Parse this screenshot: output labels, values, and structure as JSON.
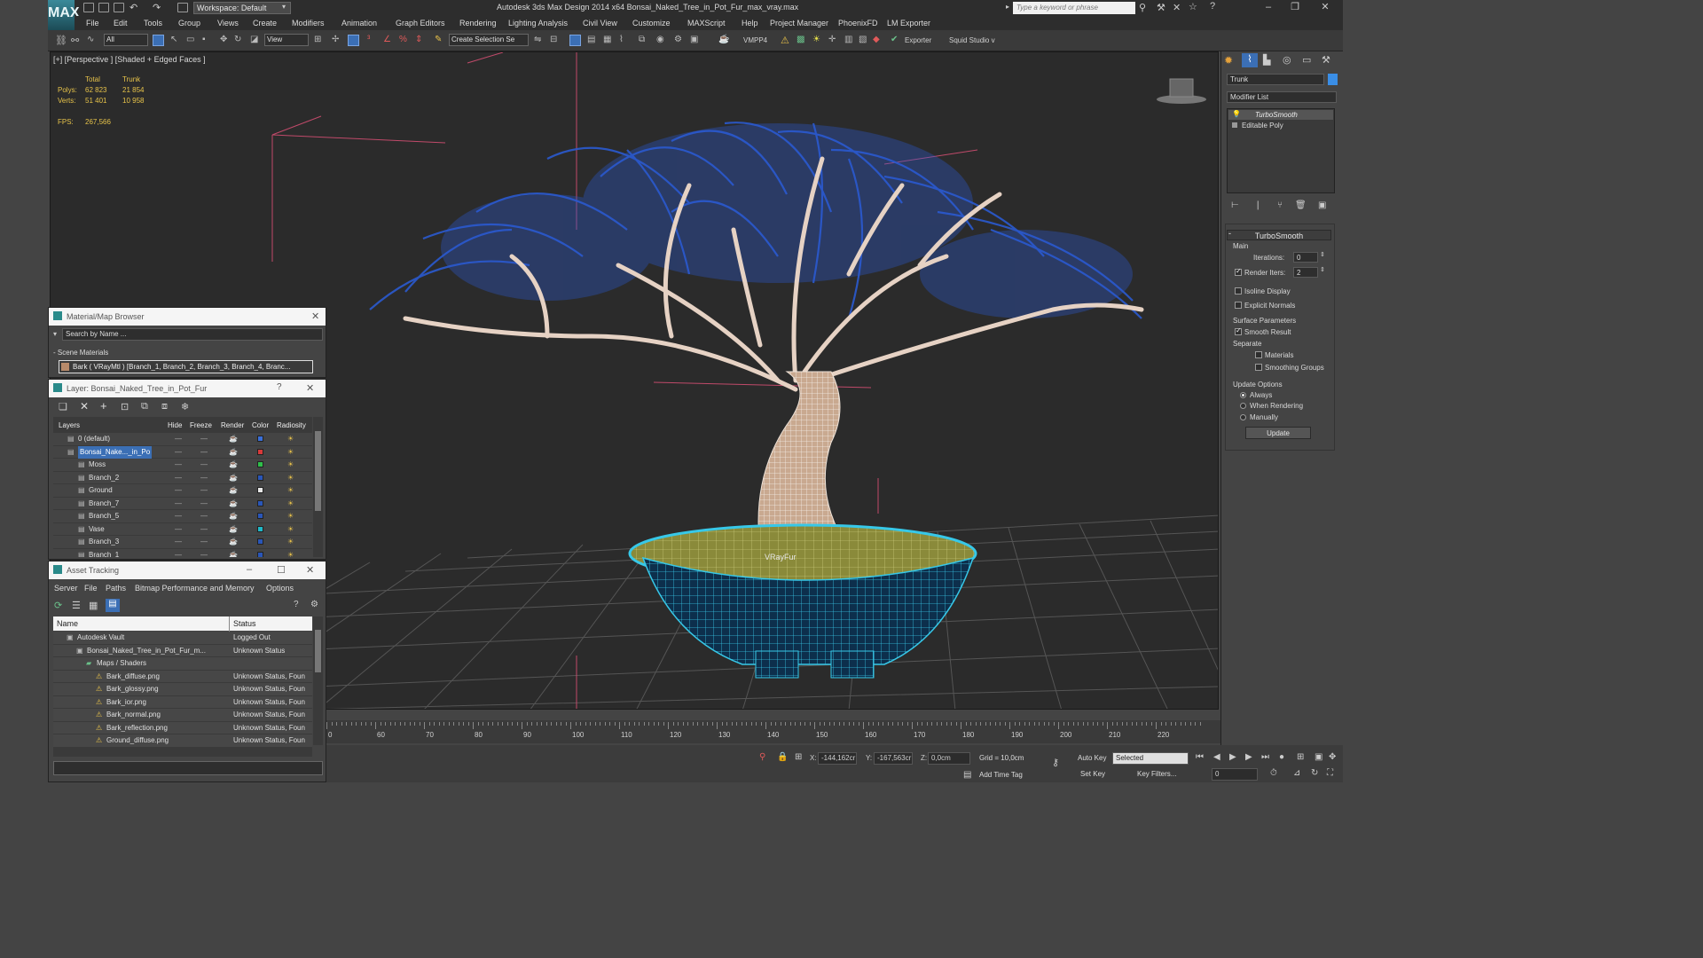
{
  "app": {
    "title": "Autodesk 3ds Max Design 2014 x64     Bonsai_Naked_Tree_in_Pot_Fur_max_vray.max",
    "logo": "MAX",
    "workspace": "Workspace: Default",
    "search_placeholder": "Type a keyword or phrase"
  },
  "menu": [
    "File",
    "Edit",
    "Tools",
    "Group",
    "Views",
    "Create",
    "Modifiers",
    "Animation",
    "Graph Editors",
    "Rendering",
    "Lighting Analysis",
    "Civil View",
    "Customize",
    "MAXScript",
    "Help",
    "Project Manager",
    "PhoenixFD",
    "LM Exporter"
  ],
  "toolbar": {
    "filter": "All",
    "ref_coord": "View",
    "selection_set": "Create Selection Se",
    "vmpp": "VMPP4",
    "exporter": "Exporter",
    "squid": "Squid Studio v"
  },
  "viewport": {
    "label": "[+] [Perspective ] [Shaded + Edged Faces ]",
    "stats": {
      "col_total": "Total",
      "col_trunk": "Trunk",
      "polys_label": "Polys:",
      "polys_total": "62 823",
      "polys_trunk": "21 854",
      "verts_label": "Verts:",
      "verts_total": "51 401",
      "verts_trunk": "10 958",
      "fps_label": "FPS:",
      "fps_value": "267,566"
    },
    "fur_label": "VRayFur"
  },
  "modify_panel": {
    "object_name": "Trunk",
    "object_color": "#3a8ee6",
    "modifier_list": "Modifier List",
    "stack": [
      "TurboSmooth",
      "Editable Poly"
    ],
    "turbosmooth": {
      "title": "TurboSmooth",
      "main": "Main",
      "iterations_label": "Iterations:",
      "iterations": "0",
      "render_iters_label": "Render Iters:",
      "render_iters": "2",
      "isoline": "Isoline Display",
      "explicit": "Explicit Normals",
      "surface": "Surface Parameters",
      "smooth_result": "Smooth Result",
      "separate": "Separate",
      "materials": "Materials",
      "smoothing_groups": "Smoothing Groups",
      "update_options": "Update Options",
      "always": "Always",
      "when_rendering": "When Rendering",
      "manually": "Manually",
      "update_btn": "Update"
    }
  },
  "material_browser": {
    "title": "Material/Map Browser",
    "search": "Search by Name ...",
    "section": "- Scene Materials",
    "item": "Bark  ( VRayMtl )  [Branch_1, Branch_2, Branch_3, Branch_4, Branc..."
  },
  "layer_panel": {
    "title": "Layer: Bonsai_Naked_Tree_in_Pot_Fur",
    "columns": [
      "Layers",
      "Hide",
      "Freeze",
      "Render",
      "Color",
      "Radiosity"
    ],
    "rows": [
      {
        "name": "0 (default)",
        "color": "#3a6fd8",
        "indent": 0,
        "selected": false
      },
      {
        "name": "Bonsai_Nake..._in_Po",
        "color": "#d83a3a",
        "indent": 0,
        "selected": true
      },
      {
        "name": "Moss",
        "color": "#2fbf4a",
        "indent": 1,
        "selected": false
      },
      {
        "name": "Branch_2",
        "color": "#2a56b8",
        "indent": 1,
        "selected": false
      },
      {
        "name": "Ground",
        "color": "#e8e8e8",
        "indent": 1,
        "selected": false
      },
      {
        "name": "Branch_7",
        "color": "#2a56b8",
        "indent": 1,
        "selected": false
      },
      {
        "name": "Branch_5",
        "color": "#2a56b8",
        "indent": 1,
        "selected": false
      },
      {
        "name": "Vase",
        "color": "#1fb8c8",
        "indent": 1,
        "selected": false
      },
      {
        "name": "Branch_3",
        "color": "#2a56b8",
        "indent": 1,
        "selected": false
      },
      {
        "name": "Branch_1",
        "color": "#2a56b8",
        "indent": 1,
        "selected": false
      }
    ]
  },
  "asset_tracking": {
    "title": "Asset Tracking",
    "menu": [
      "Server",
      "File",
      "Paths",
      "Bitmap Performance and Memory",
      "Options"
    ],
    "columns": [
      "Name",
      "Status"
    ],
    "rows": [
      {
        "name": "Autodesk Vault",
        "status": "Logged Out",
        "indent": 1
      },
      {
        "name": "Bonsai_Naked_Tree_in_Pot_Fur_m...",
        "status": "Unknown Status",
        "indent": 2
      },
      {
        "name": "Maps / Shaders",
        "status": "",
        "indent": 3
      },
      {
        "name": "Bark_diffuse.png",
        "status": "Unknown Status, Foun",
        "indent": 4
      },
      {
        "name": "Bark_glossy.png",
        "status": "Unknown Status, Foun",
        "indent": 4
      },
      {
        "name": "Bark_ior.png",
        "status": "Unknown Status, Foun",
        "indent": 4
      },
      {
        "name": "Bark_normal.png",
        "status": "Unknown Status, Foun",
        "indent": 4
      },
      {
        "name": "Bark_reflection.png",
        "status": "Unknown Status, Foun",
        "indent": 4
      },
      {
        "name": "Ground_diffuse.png",
        "status": "Unknown Status, Foun",
        "indent": 4
      }
    ]
  },
  "timeline": {
    "ticks": [
      "0",
      "60",
      "70",
      "80",
      "90",
      "100",
      "110",
      "120",
      "130",
      "140",
      "150",
      "160",
      "170",
      "180",
      "190",
      "200",
      "210",
      "220"
    ]
  },
  "status": {
    "x_label": "X:",
    "x_val": "-144,162cr",
    "y_label": "Y:",
    "y_val": "-167,563cr",
    "z_label": "Z:",
    "z_val": "0,0cm",
    "grid": "Grid = 10,0cm",
    "add_time_tag": "Add Time Tag",
    "auto_key": "Auto Key",
    "set_key": "Set Key",
    "selected": "Selected",
    "key_filters": "Key Filters...",
    "frame": "0"
  }
}
